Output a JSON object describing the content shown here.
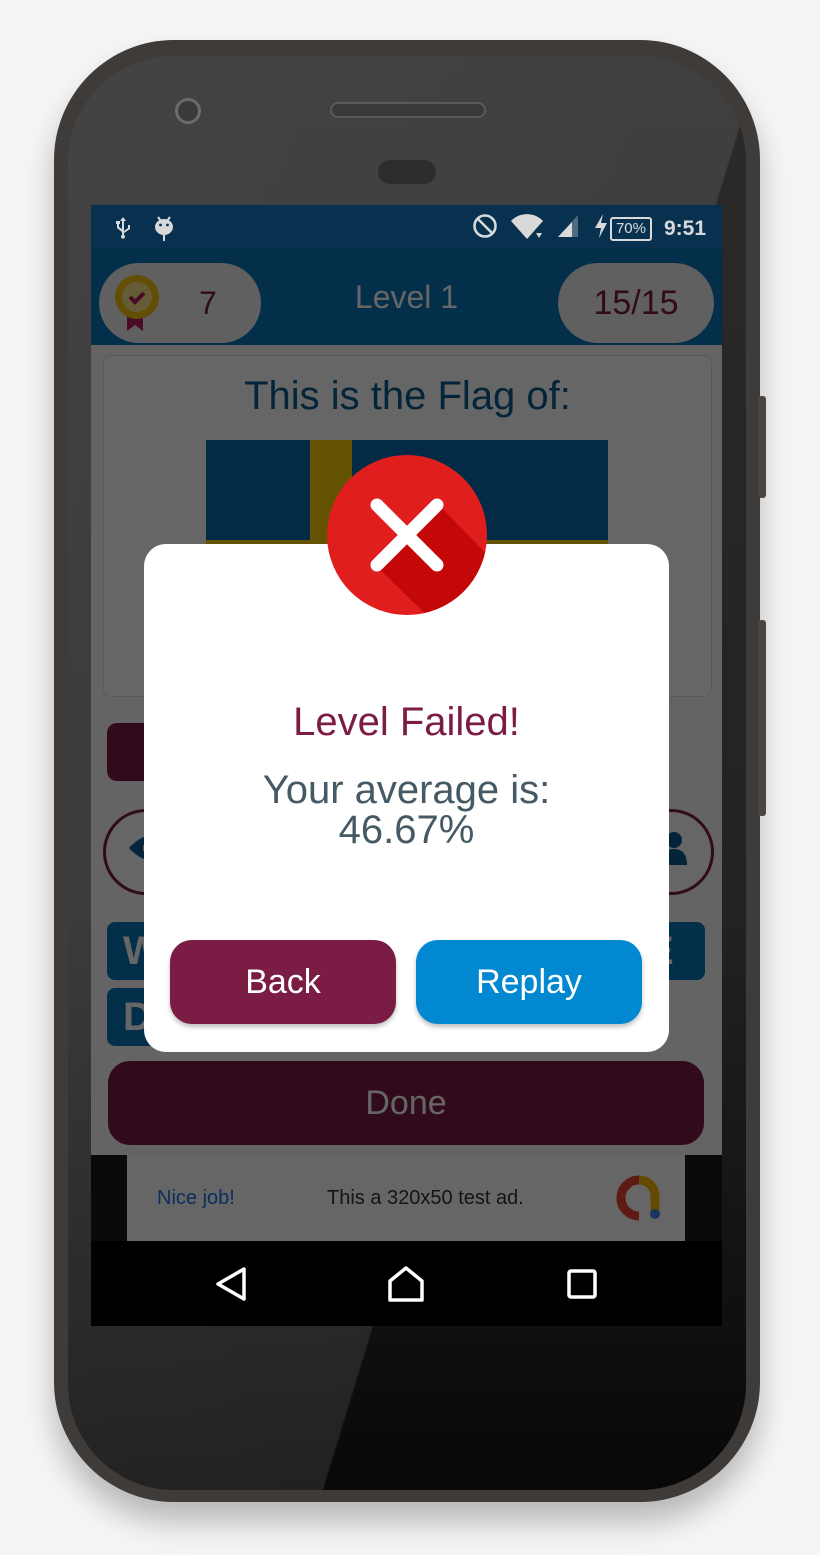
{
  "status_bar": {
    "left_icons": [
      "usb-icon",
      "android-debug-icon"
    ],
    "right_icons": [
      "do-not-disturb-icon",
      "wifi-icon",
      "cell-signal-icon",
      "charging-icon"
    ],
    "battery": "70%",
    "time": "9:51"
  },
  "app_bar": {
    "coins_icon": "medal-icon",
    "coins": "7",
    "title": "Level 1",
    "progress": "15/15"
  },
  "question": {
    "title": "This is the Flag of:",
    "flag_icon": "sweden-flag",
    "flag_colors": {
      "field": "#0c6bb0",
      "cross": "#f9cf08"
    }
  },
  "hint_buttons": {
    "left_icon": "eye-icon",
    "right_icon": "people-icon"
  },
  "answer_tiles": {
    "left_top": "W",
    "left_bottom": "D",
    "right_top": "E"
  },
  "done_button": "Done",
  "ad": {
    "headline": "Nice job!",
    "text": "This a 320x50 test ad.",
    "logo_icon": "admob-logo-icon"
  },
  "dialog": {
    "status_icon": "failed-x-icon",
    "title": "Level Failed!",
    "message_line1": "Your average is:",
    "average": "46.67%",
    "back_label": "Back",
    "replay_label": "Replay"
  },
  "navbar": {
    "back_icon": "nav-back-icon",
    "home_icon": "nav-home-icon",
    "recents_icon": "nav-recents-icon"
  },
  "colors": {
    "primary": "#0a76b8",
    "accent": "#7b1c44",
    "replay": "#0288d1",
    "fail_red": "#e01e1e"
  }
}
